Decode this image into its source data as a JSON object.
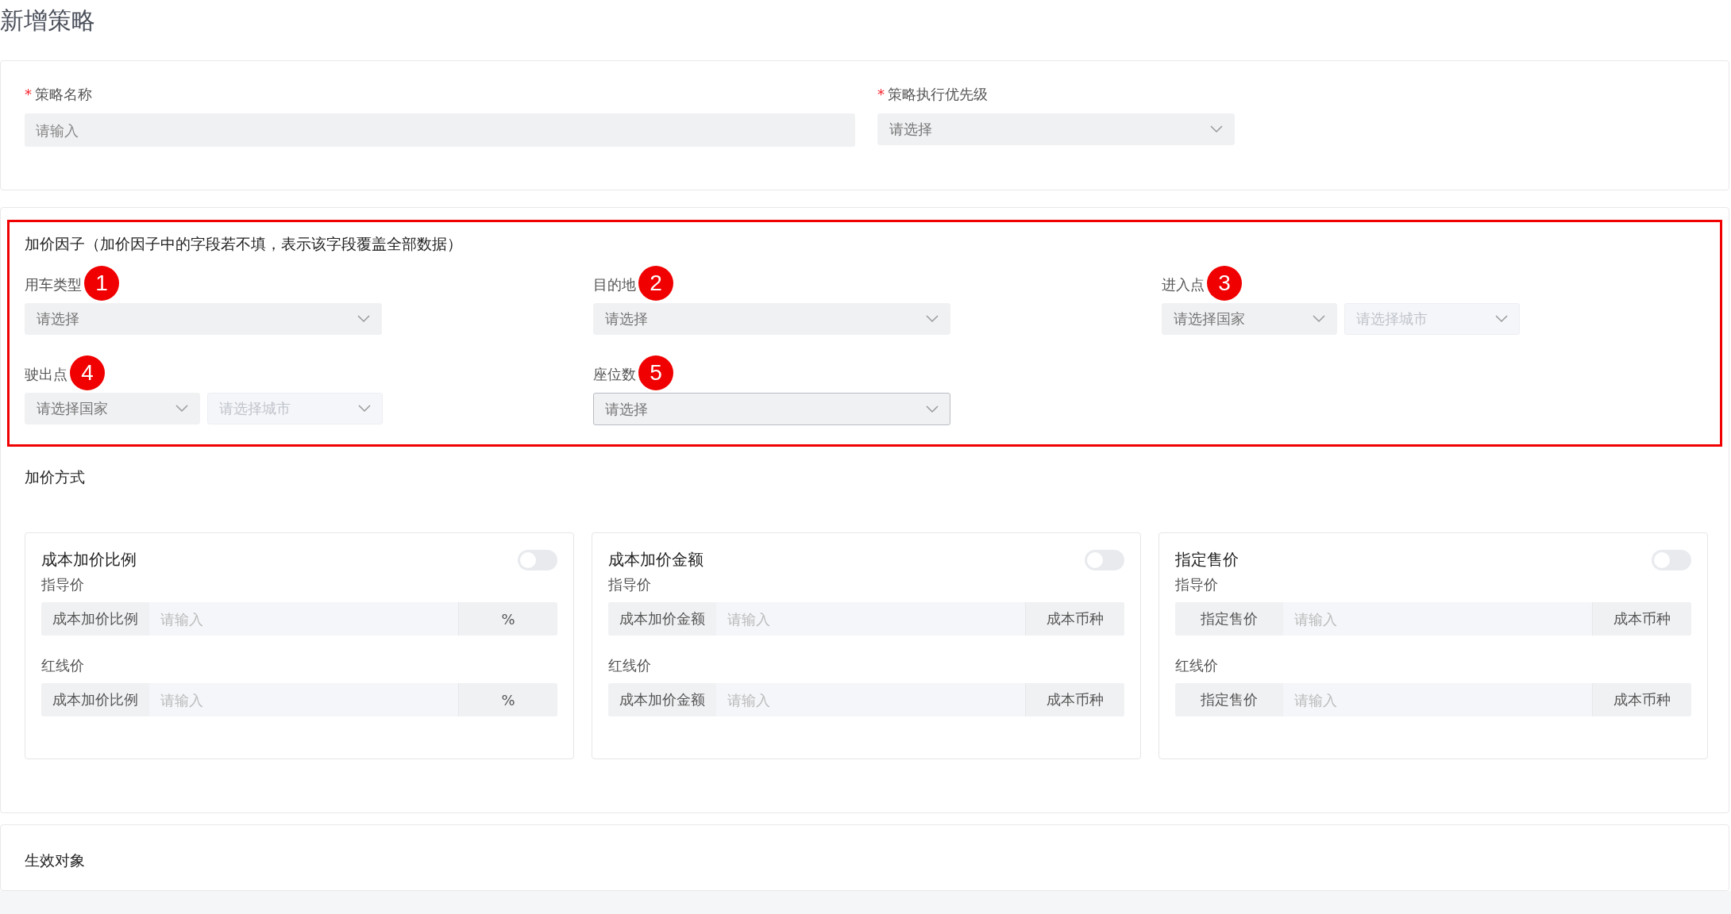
{
  "page_title": "新增策略",
  "basic": {
    "required_mark": "*",
    "fields": [
      {
        "label": "策略名称",
        "required": true,
        "kind": "input",
        "placeholder": "请输入"
      },
      {
        "label": "策略执行优先级",
        "required": true,
        "kind": "select",
        "placeholder": "请选择"
      }
    ]
  },
  "factors": {
    "title": "加价因子（加价因子中的字段若不填，表示该字段覆盖全部数据）",
    "highlighted": true,
    "items": [
      {
        "label": "用车类型",
        "badge": "1",
        "kind": "single",
        "selects": [
          {
            "placeholder": "请选择",
            "disabled": false,
            "focused": false
          }
        ]
      },
      {
        "label": "目的地",
        "badge": "2",
        "kind": "single",
        "selects": [
          {
            "placeholder": "请选择",
            "disabled": false,
            "focused": false
          }
        ]
      },
      {
        "label": "进入点",
        "badge": "3",
        "kind": "pair",
        "selects": [
          {
            "placeholder": "请选择国家",
            "disabled": false,
            "focused": false
          },
          {
            "placeholder": "请选择城市",
            "disabled": true,
            "focused": false
          }
        ]
      },
      {
        "label": "驶出点",
        "badge": "4",
        "kind": "pair",
        "selects": [
          {
            "placeholder": "请选择国家",
            "disabled": false,
            "focused": false
          },
          {
            "placeholder": "请选择城市",
            "disabled": true,
            "focused": false
          }
        ]
      },
      {
        "label": "座位数",
        "badge": "5",
        "kind": "single",
        "selects": [
          {
            "placeholder": "请选择",
            "disabled": false,
            "focused": true
          }
        ]
      }
    ]
  },
  "pricing": {
    "title": "加价方式",
    "methods": [
      {
        "title": "成本加价比例",
        "on": false,
        "rows": [
          {
            "label": "指导价",
            "prefix": "成本加价比例",
            "placeholder": "请输入",
            "suffix": "%"
          },
          {
            "label": "红线价",
            "prefix": "成本加价比例",
            "placeholder": "请输入",
            "suffix": "%"
          }
        ]
      },
      {
        "title": "成本加价金额",
        "on": false,
        "rows": [
          {
            "label": "指导价",
            "prefix": "成本加价金额",
            "placeholder": "请输入",
            "suffix": "成本币种"
          },
          {
            "label": "红线价",
            "prefix": "成本加价金额",
            "placeholder": "请输入",
            "suffix": "成本币种"
          }
        ]
      },
      {
        "title": "指定售价",
        "on": false,
        "rows": [
          {
            "label": "指导价",
            "prefix": "指定售价",
            "placeholder": "请输入",
            "suffix": "成本币种"
          },
          {
            "label": "红线价",
            "prefix": "指定售价",
            "placeholder": "请输入",
            "suffix": "成本币种"
          }
        ]
      }
    ]
  },
  "scope": {
    "title": "生效对象"
  }
}
